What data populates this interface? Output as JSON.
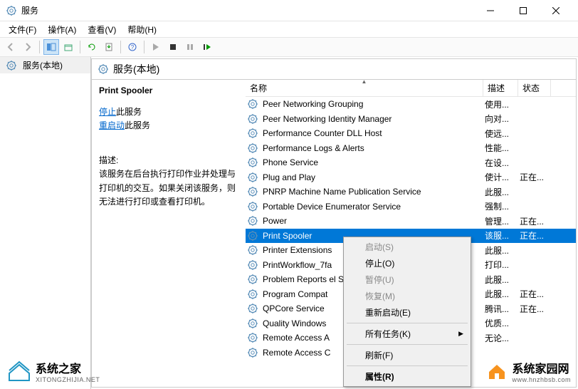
{
  "window": {
    "title": "服务"
  },
  "menu": {
    "file": "文件(F)",
    "action": "操作(A)",
    "view": "查看(V)",
    "help": "帮助(H)"
  },
  "tree": {
    "root": "服务(本地)"
  },
  "header": {
    "title": "服务(本地)"
  },
  "detail": {
    "service_name": "Print Spooler",
    "stop_link": "停止",
    "stop_suffix": "此服务",
    "restart_link": "重启动",
    "restart_suffix": "此服务",
    "desc_label": "描述:",
    "desc_text": "该服务在后台执行打印作业并处理与打印机的交互。如果关闭该服务，则无法进行打印或查看打印机。"
  },
  "columns": {
    "name": "名称",
    "desc": "描述",
    "status": "状态"
  },
  "services": [
    {
      "name": "Peer Networking Grouping",
      "desc": "使用...",
      "status": ""
    },
    {
      "name": "Peer Networking Identity Manager",
      "desc": "向对...",
      "status": ""
    },
    {
      "name": "Performance Counter DLL Host",
      "desc": "使远...",
      "status": ""
    },
    {
      "name": "Performance Logs & Alerts",
      "desc": "性能...",
      "status": ""
    },
    {
      "name": "Phone Service",
      "desc": "在设...",
      "status": ""
    },
    {
      "name": "Plug and Play",
      "desc": "使计...",
      "status": "正在..."
    },
    {
      "name": "PNRP Machine Name Publication Service",
      "desc": "此服...",
      "status": ""
    },
    {
      "name": "Portable Device Enumerator Service",
      "desc": "强制...",
      "status": ""
    },
    {
      "name": "Power",
      "desc": "管理...",
      "status": "正在..."
    },
    {
      "name": "Print Spooler",
      "desc": "该服...",
      "status": "正在...",
      "selected": true
    },
    {
      "name": "Printer Extensions",
      "desc": "此服...",
      "status": ""
    },
    {
      "name": "PrintWorkflow_7fa",
      "desc": "打印...",
      "status": ""
    },
    {
      "name": "Problem Reports                                el Support",
      "desc": "此服...",
      "status": ""
    },
    {
      "name": "Program Compat",
      "desc": "此服...",
      "status": "正在..."
    },
    {
      "name": "QPCore Service",
      "desc": "腾讯...",
      "status": "正在..."
    },
    {
      "name": "Quality Windows",
      "desc": "优质...",
      "status": ""
    },
    {
      "name": "Remote Access A",
      "desc": "无论...",
      "status": ""
    },
    {
      "name": "Remote Access C",
      "desc": "",
      "status": ""
    }
  ],
  "context_menu": {
    "start": "启动(S)",
    "stop": "停止(O)",
    "pause": "暂停(U)",
    "resume": "恢复(M)",
    "restart": "重新启动(E)",
    "all_tasks": "所有任务(K)",
    "refresh": "刷新(F)",
    "properties": "属性(R)"
  },
  "watermarks": {
    "wm1_text": "系统之家",
    "wm1_sub": "XITONGZHIJIA.NET",
    "wm2_text": "系统家园网",
    "wm2_sub": "www.hnzhbsb.com"
  }
}
